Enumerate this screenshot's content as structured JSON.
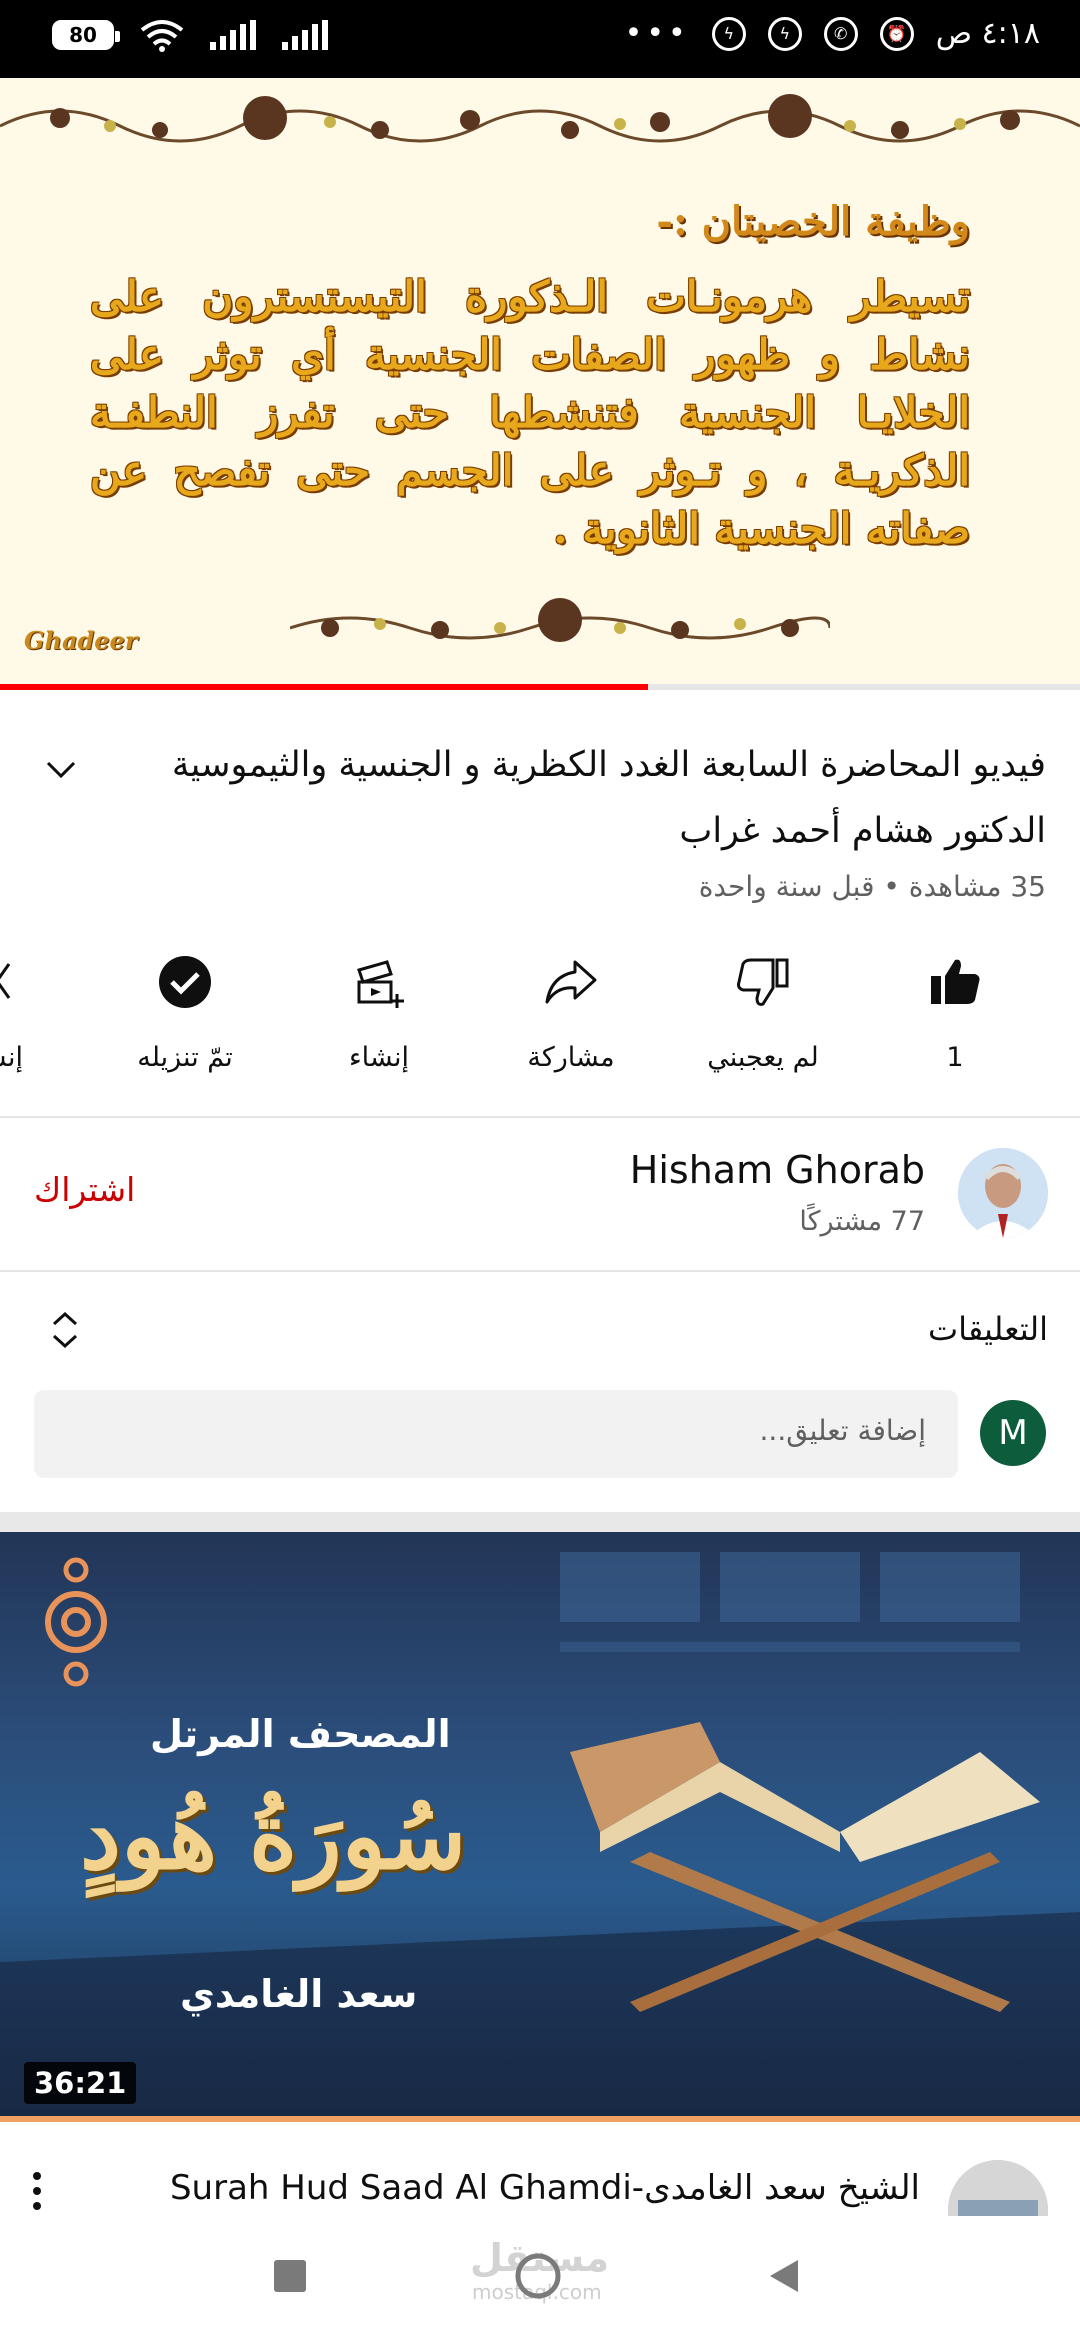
{
  "status_bar": {
    "battery": "80",
    "time": "٤:١٨ ص"
  },
  "video_player": {
    "heading": "وظيفة الخصيتان :-",
    "body": "تسيطر هرمونـات الـذكورة التيستسترون على نشاط و ظهور الصفات الجنسية أي توثر على الخلايـا الجنسية فتنشطها حتى تفرز النطفـة الذكريـة ، و تـوثر على الجسم حتى تفصح عن صفاته الجنسية الثانوية .",
    "watermark": "Ghadeer",
    "progress": 0.6
  },
  "video_info": {
    "title": "فيديو المحاضرة السابعة الغدد الكظرية و الجنسية والثيموسية الدكتور هشام أحمد غراب",
    "meta": "35 مشاهدة • قبل سنة واحدة"
  },
  "actions": {
    "like_count": "1",
    "dislike_label": "لم يعجبني",
    "share_label": "مشاركة",
    "create_label": "إنشاء",
    "downloaded_label": "تمّ تنزيله",
    "clip_label": "إنشاء"
  },
  "channel": {
    "name": "Hisham Ghorab",
    "subscribers": "77 مشتركًا",
    "subscribe_label": "اشتراك"
  },
  "comments": {
    "header": "التعليقات",
    "placeholder": "إضافة تعليق...",
    "user_initial": "M"
  },
  "next_video": {
    "thumb_line1": "المصحف المرتل",
    "thumb_line2": "سُورَةُ هُودٍ",
    "thumb_line3": "سعد الغامدي",
    "duration": "36:21",
    "title": "الشيخ سعد الغامدى-Surah Hud Saad Al Ghamdi"
  },
  "nav_watermark": {
    "text": "مستقل",
    "sub": "mostaql.com"
  },
  "colors": {
    "accent_red": "#ff0000",
    "subscribe_red": "#cc0000",
    "video_gold": "#e8a81c",
    "comment_avatar": "#0d5c3c"
  }
}
